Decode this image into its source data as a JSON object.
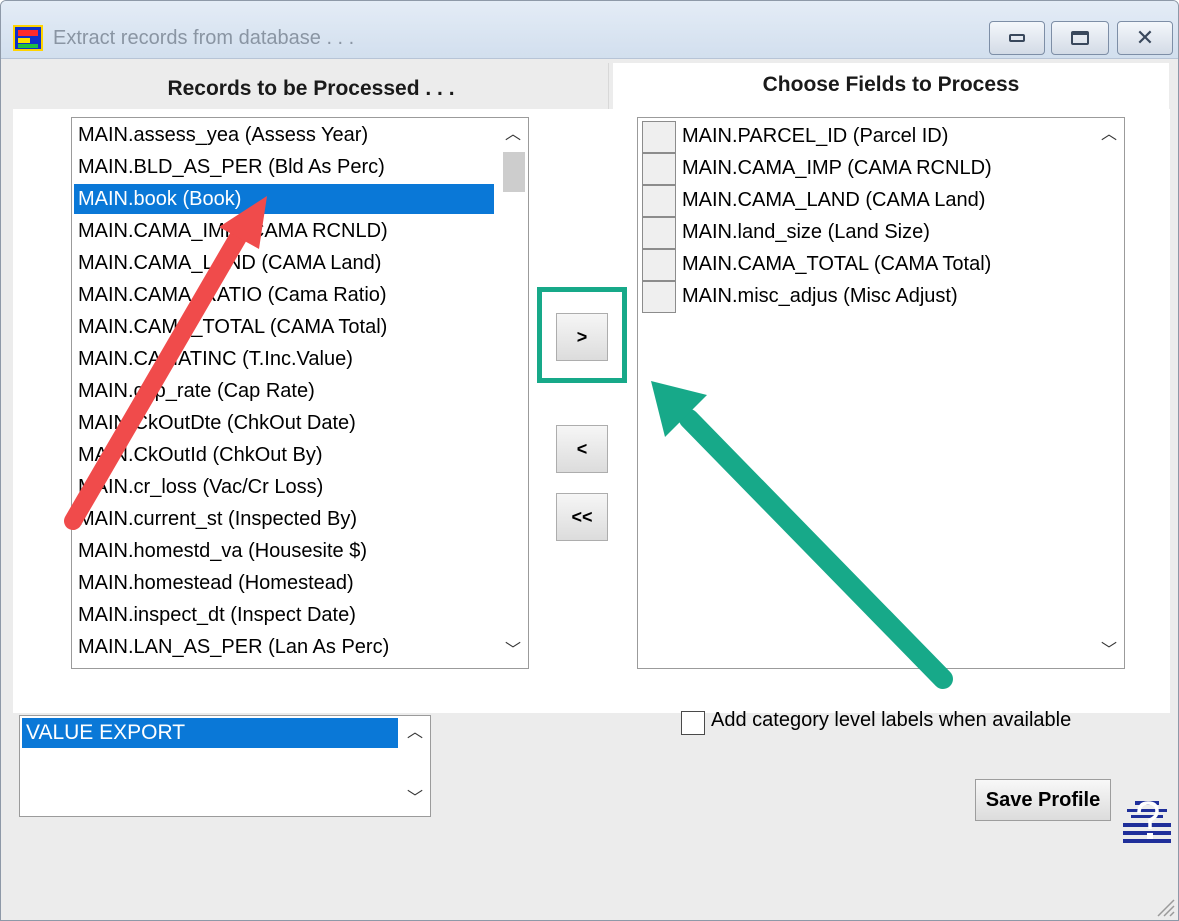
{
  "window": {
    "title": "Extract records from database . . .",
    "accent_color": "#0a78d7",
    "highlight_color": "#17a989",
    "arrow_colors": [
      "#f04b4b",
      "#17a989"
    ]
  },
  "left_panel": {
    "header": "Records to be Processed . . .",
    "items": [
      "MAIN.assess_yea (Assess Year)",
      "MAIN.BLD_AS_PER (Bld As Perc)",
      "MAIN.book (Book)",
      "MAIN.CAMA_IMP (CAMA RCNLD)",
      "MAIN.CAMA_LAND (CAMA Land)",
      "MAIN.CAMA_RATIO (Cama Ratio)",
      "MAIN.CAMA_TOTAL (CAMA Total)",
      "MAIN.CAMATINC (T.Inc.Value)",
      "MAIN.cap_rate (Cap Rate)",
      "MAIN.CkOutDte (ChkOut Date)",
      "MAIN.CkOutId (ChkOut By)",
      "MAIN.cr_loss (Vac/Cr Loss)",
      "MAIN.current_st (Inspected By)",
      "MAIN.homestd_va (Housesite $)",
      "MAIN.homestead (Homestead)",
      "MAIN.inspect_dt (Inspect Date)",
      "MAIN.LAN_AS_PER (Lan As Perc)"
    ],
    "selected_item": "MAIN.book (Book)"
  },
  "right_panel": {
    "header": "Choose Fields to Process",
    "items": [
      "MAIN.PARCEL_ID (Parcel ID)",
      "MAIN.CAMA_IMP (CAMA RCNLD)",
      "MAIN.CAMA_LAND (CAMA Land)",
      "MAIN.land_size (Land Size)",
      "MAIN.CAMA_TOTAL (CAMA Total)",
      "MAIN.misc_adjus (Misc Adjust)"
    ]
  },
  "buttons": {
    "add": ">",
    "remove": "<",
    "remove_all": "<<",
    "save_profile": "Save Profile"
  },
  "profiles": {
    "items": [
      "VALUE EXPORT"
    ],
    "selected_item": "VALUE EXPORT"
  },
  "options": {
    "category_labels": "Add category level labels when available",
    "category_labels_checked": false
  },
  "icons": {
    "app": "app-grid-icon",
    "minimize": "minimize-icon",
    "maximize": "maximize-icon",
    "close": "close-icon",
    "scroll_up": "chevron-up-icon",
    "scroll_down": "chevron-down-icon",
    "help": "help-question-icon",
    "resize": "resize-grip-icon"
  }
}
